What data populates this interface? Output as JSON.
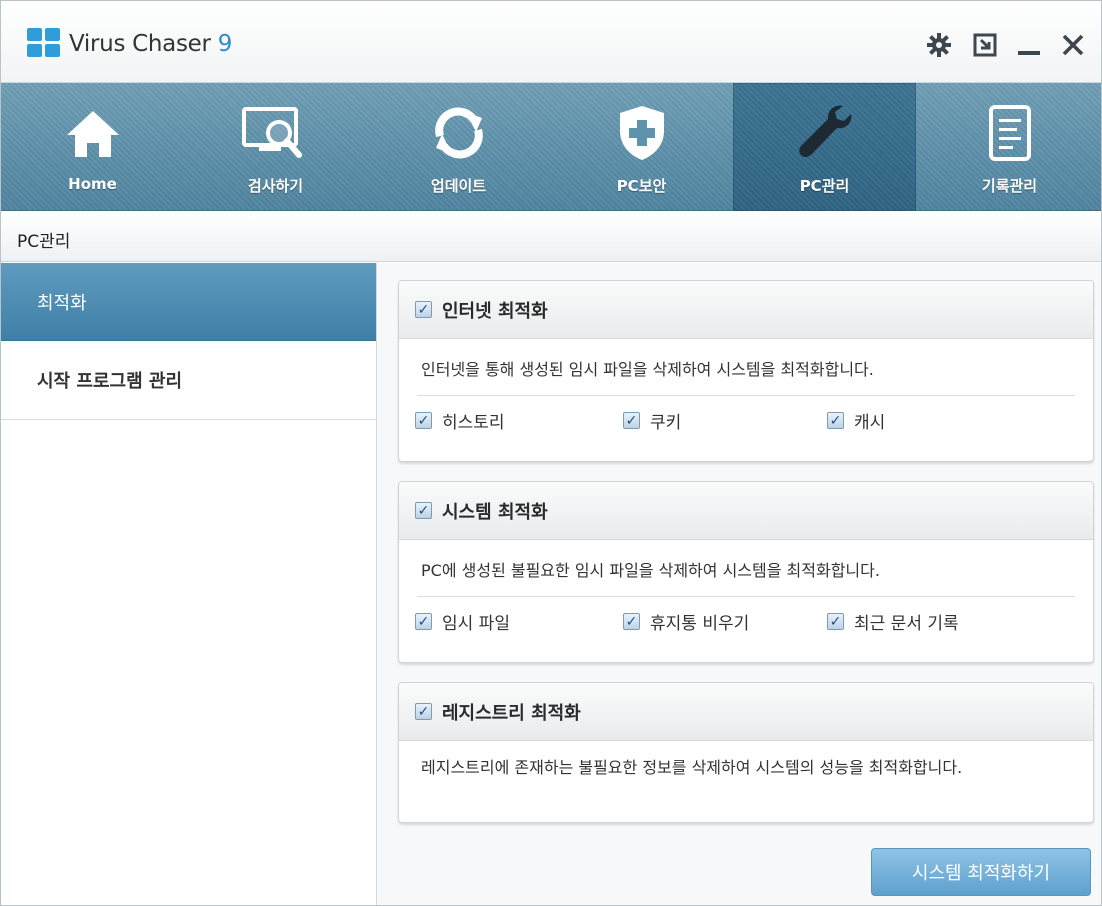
{
  "app": {
    "name": "Virus Chaser ",
    "version": "9"
  },
  "titlebar_controls": [
    {
      "icon": "gear-icon"
    },
    {
      "icon": "minimize-to-tray-icon"
    },
    {
      "icon": "minimize-icon"
    },
    {
      "icon": "close-icon"
    }
  ],
  "nav": {
    "items": [
      {
        "label": "Home",
        "icon": "home-icon"
      },
      {
        "label": "검사하기",
        "icon": "scan-monitor-icon"
      },
      {
        "label": "업데이트",
        "icon": "update-refresh-icon"
      },
      {
        "label": "PC보안",
        "icon": "shield-plus-icon"
      },
      {
        "label": "PC관리",
        "icon": "wrench-icon",
        "active": true
      },
      {
        "label": "기록관리",
        "icon": "document-icon"
      }
    ]
  },
  "section": {
    "title": "PC관리"
  },
  "sidebar": {
    "items": [
      {
        "label": "최적화",
        "active": true
      },
      {
        "label": "시작 프로그램 관리"
      }
    ]
  },
  "panels": [
    {
      "title": "인터넷 최적화",
      "checked": true,
      "description": "인터넷을 통해 생성된 임시 파일을 삭제하여 시스템을 최적화합니다.",
      "options": [
        {
          "label": "히스토리",
          "checked": true
        },
        {
          "label": "쿠키",
          "checked": true
        },
        {
          "label": "캐시",
          "checked": true
        }
      ]
    },
    {
      "title": "시스템 최적화",
      "checked": true,
      "description": "PC에 생성된 불필요한 임시 파일을 삭제하여 시스템을 최적화합니다.",
      "options": [
        {
          "label": "임시 파일",
          "checked": true
        },
        {
          "label": "휴지통 비우기",
          "checked": true
        },
        {
          "label": "최근 문서 기록",
          "checked": true
        }
      ]
    },
    {
      "title": "레지스트리 최적화",
      "checked": true,
      "description": "레지스트리에 존재하는 불필요한 정보를 삭제하여 시스템의 성능을 최적화합니다."
    }
  ],
  "action": {
    "label": "시스템 최적화하기"
  },
  "colors": {
    "accent": "#2f9ed8",
    "nav_bg": "#5f92ab",
    "nav_active": "#2f6584",
    "sidebar_active": "#4f8db5"
  }
}
